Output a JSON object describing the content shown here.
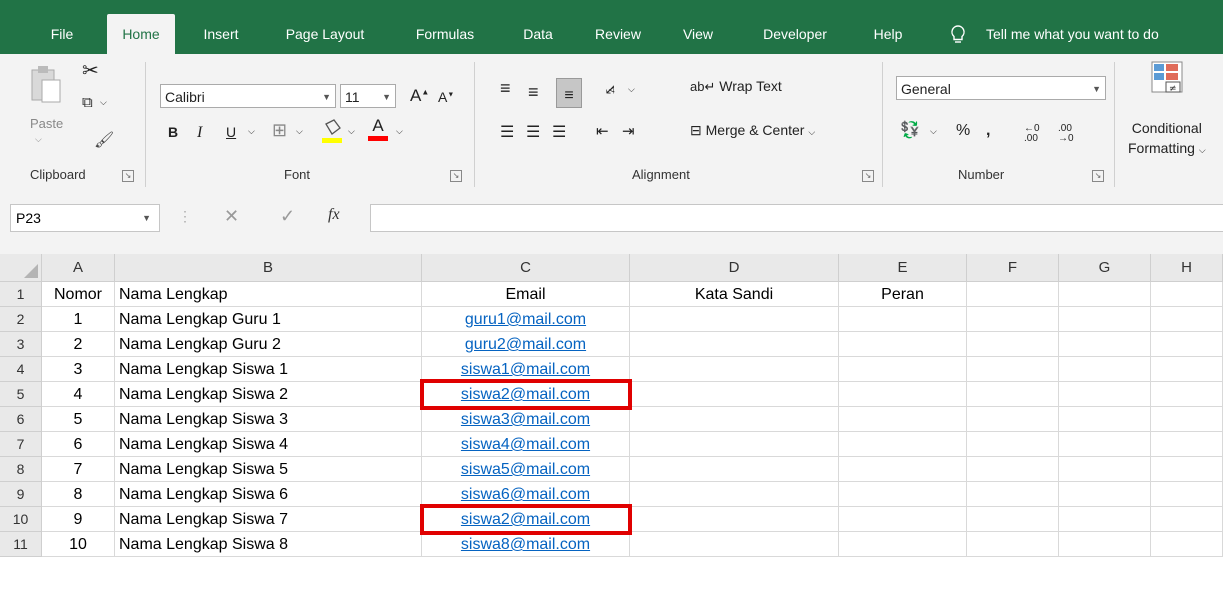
{
  "menu": {
    "tabs": [
      "File",
      "Home",
      "Insert",
      "Page Layout",
      "Formulas",
      "Data",
      "Review",
      "View",
      "Developer",
      "Help"
    ],
    "active_tab": "Home",
    "tell_me": "Tell me what you want to do"
  },
  "ribbon": {
    "clipboard": {
      "paste": "Paste",
      "label": "Clipboard"
    },
    "font": {
      "name": "Calibri",
      "size": "11",
      "bold": "B",
      "italic": "I",
      "underline": "U",
      "grow": "A",
      "shrink": "A",
      "color_a": "A",
      "label": "Font",
      "fill_color": "#ffff00",
      "font_color": "#ff0000"
    },
    "alignment": {
      "wrap": "Wrap Text",
      "merge": "Merge & Center",
      "label": "Alignment"
    },
    "number": {
      "format": "General",
      "percent": "%",
      "comma": ",",
      "label": "Number"
    },
    "styles": {
      "conditional_1": "Conditional",
      "conditional_2": "Formatting"
    }
  },
  "formula_bar": {
    "name_box": "P23",
    "fx": "fx",
    "value": ""
  },
  "columns": [
    "A",
    "B",
    "C",
    "D",
    "E",
    "F",
    "G",
    "H"
  ],
  "rows": [
    {
      "n": "1",
      "a": "Nomor",
      "b": "Nama Lengkap",
      "c": "Email",
      "d": "Kata Sandi",
      "e": "Peran"
    },
    {
      "n": "2",
      "a": "1",
      "b": "Nama Lengkap Guru 1",
      "c": "guru1@mail.com",
      "d": "",
      "e": ""
    },
    {
      "n": "3",
      "a": "2",
      "b": "Nama Lengkap Guru 2",
      "c": "guru2@mail.com",
      "d": "",
      "e": ""
    },
    {
      "n": "4",
      "a": "3",
      "b": "Nama Lengkap Siswa 1",
      "c": "siswa1@mail.com",
      "d": "",
      "e": ""
    },
    {
      "n": "5",
      "a": "4",
      "b": "Nama Lengkap Siswa 2",
      "c": "siswa2@mail.com",
      "d": "",
      "e": ""
    },
    {
      "n": "6",
      "a": "5",
      "b": "Nama Lengkap Siswa 3",
      "c": "siswa3@mail.com",
      "d": "",
      "e": ""
    },
    {
      "n": "7",
      "a": "6",
      "b": "Nama Lengkap Siswa 4",
      "c": "siswa4@mail.com",
      "d": "",
      "e": ""
    },
    {
      "n": "8",
      "a": "7",
      "b": "Nama Lengkap Siswa 5",
      "c": "siswa5@mail.com",
      "d": "",
      "e": ""
    },
    {
      "n": "9",
      "a": "8",
      "b": "Nama Lengkap Siswa 6",
      "c": "siswa6@mail.com",
      "d": "",
      "e": ""
    },
    {
      "n": "10",
      "a": "9",
      "b": "Nama Lengkap Siswa 7",
      "c": "siswa2@mail.com",
      "d": "",
      "e": ""
    },
    {
      "n": "11",
      "a": "10",
      "b": "Nama Lengkap Siswa 8",
      "c": "siswa8@mail.com",
      "d": "",
      "e": ""
    }
  ],
  "highlighted_rows": [
    "5",
    "10"
  ],
  "colors": {
    "excel_green": "#217346",
    "link_blue": "#0563c1",
    "highlight_red": "#e00000"
  }
}
